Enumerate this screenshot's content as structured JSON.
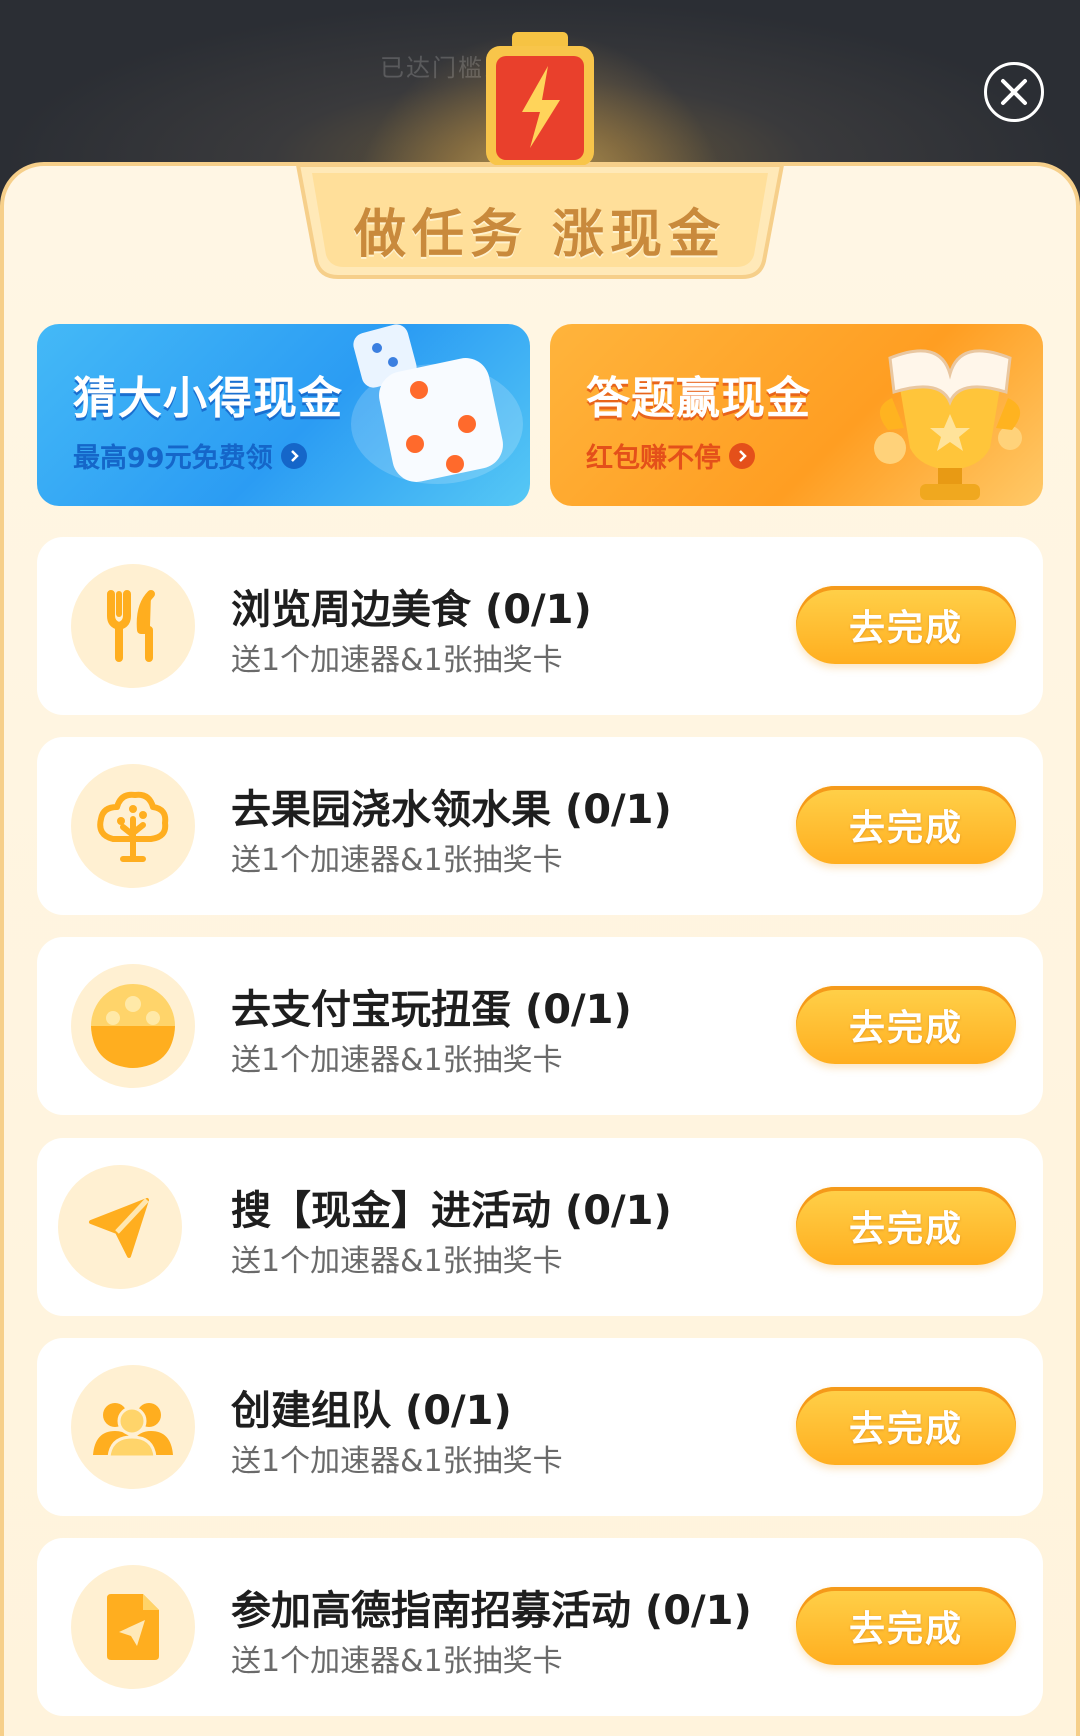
{
  "background": {
    "hint_text": "已达门槛即可提现"
  },
  "header": {
    "title": "做任务 涨现金"
  },
  "banners": [
    {
      "title": "猜大小得现金",
      "subtitle": "最高99元免费领",
      "color": "#2b9cf3",
      "art": "dice-icon"
    },
    {
      "title": "答题赢现金",
      "subtitle": "红包赚不停",
      "color": "#ff9e22",
      "art": "trophy-book-icon"
    }
  ],
  "tasks": [
    {
      "title": "浏览周边美食 (0/1)",
      "reward": "送1个加速器&1张抽奖卡",
      "button": "去完成",
      "icon": "fork-knife-icon"
    },
    {
      "title": "去果园浇水领水果 (0/1)",
      "reward": "送1个加速器&1张抽奖卡",
      "button": "去完成",
      "icon": "tree-icon"
    },
    {
      "title": "去支付宝玩扭蛋 (0/1)",
      "reward": "送1个加速器&1张抽奖卡",
      "button": "去完成",
      "icon": "gacha-egg-icon"
    },
    {
      "title": "搜【现金】进活动 (0/1)",
      "reward": "送1个加速器&1张抽奖卡",
      "button": "去完成",
      "icon": "paper-plane-icon"
    },
    {
      "title": "创建组队 (0/1)",
      "reward": "送1个加速器&1张抽奖卡",
      "button": "去完成",
      "icon": "team-icon"
    },
    {
      "title": "参加高德指南招募活动 (0/1)",
      "reward": "送1个加速器&1张抽奖卡",
      "button": "去完成",
      "icon": "document-send-icon"
    }
  ],
  "colors": {
    "accent": "#ffae1f",
    "panel": "#fff6e4",
    "icon_bg": "#fff0d2"
  }
}
